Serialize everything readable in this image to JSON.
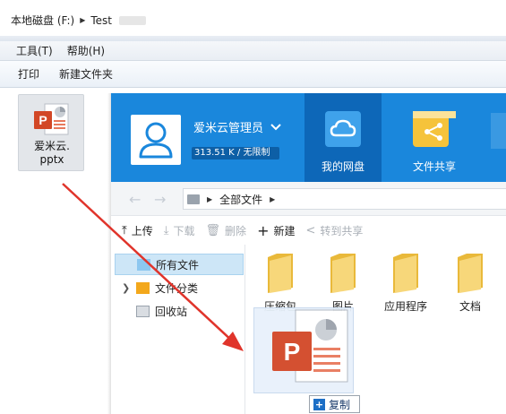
{
  "explorer": {
    "breadcrumb": [
      "本地磁盘 (F:)",
      "Test"
    ],
    "menus": [
      "工具(T)",
      "帮助(H)"
    ],
    "toolbar": [
      "打印",
      "新建文件夹"
    ],
    "file": {
      "name_line1": "爱米云.",
      "name_line2": "pptx",
      "icon": "powerpoint-file-icon"
    }
  },
  "app": {
    "user": {
      "name": "爱米云管理员",
      "quota": "313.51 K / 无限制"
    },
    "nav": [
      {
        "label": "我的网盘",
        "icon": "cloud-icon",
        "active": true
      },
      {
        "label": "文件共享",
        "icon": "share-icon",
        "active": false
      }
    ],
    "path": {
      "root": "全部文件"
    },
    "actions": [
      {
        "label": "上传",
        "icon": "upload-icon",
        "enabled": true
      },
      {
        "label": "下载",
        "icon": "download-icon",
        "enabled": false
      },
      {
        "label": "删除",
        "icon": "trash-icon",
        "enabled": false
      },
      {
        "label": "新建",
        "icon": "plus-icon",
        "enabled": true
      },
      {
        "label": "转到共享",
        "icon": "share-icon",
        "enabled": false
      }
    ],
    "tree": [
      {
        "label": "所有文件",
        "selected": true
      },
      {
        "label": "文件分类",
        "selected": false
      },
      {
        "label": "回收站",
        "selected": false
      }
    ],
    "folders": [
      "压缩包",
      "图片",
      "应用程序",
      "文档"
    ]
  },
  "drag": {
    "badge": "复制"
  },
  "colors": {
    "brand": "#1a87dc",
    "brand_dark": "#0d67b8",
    "arrow": "#e0342b",
    "folder": "#f2c94c"
  }
}
